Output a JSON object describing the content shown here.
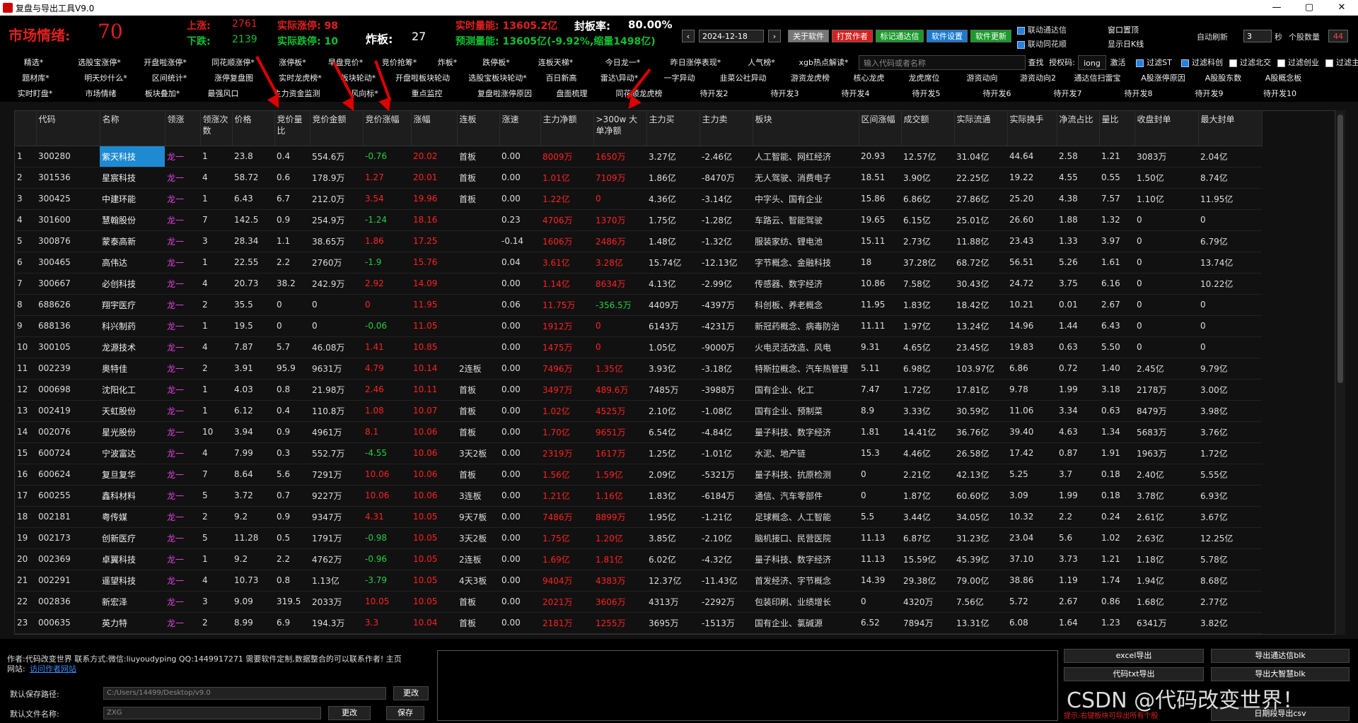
{
  "window": {
    "title": "复盘与导出工具V9.0",
    "minimize": "—",
    "maximize": "▢",
    "close": "✕"
  },
  "stats": {
    "mood_label": "市场情绪:",
    "mood_value": "70",
    "up_label": "上涨:",
    "up_value": "2761",
    "down_label": "下跌:",
    "down_value": "2139",
    "real_limit_up": "实际涨停: 98",
    "real_limit_down": "实际跌停: 10",
    "zhaban_label": "炸板:",
    "zhaban_value": "27",
    "volume_now": "实时量能: 13605.2亿",
    "seal_rate_label": "封板率:",
    "seal_rate_value": "80.00%",
    "volume_pred": "预测量能: 13605亿(-9.92%,缩量1498亿)",
    "date": "2024-12-18",
    "prev": "‹",
    "next": "›",
    "btn_about": "关于软件",
    "btn_reward": "打赏作者",
    "btn_mark": "标记通达信",
    "btn_settings": "软件设置",
    "btn_update": "软件更新",
    "chk_link_tdx": "联动通达信",
    "chk_link_ths": "联动同花顺",
    "win_top": "窗口置顶",
    "show_day_k": "显示日K线",
    "auto_refresh": "自动刷新",
    "refresh_val": "3",
    "refresh_unit": "秒",
    "stock_count_label": "个股数量",
    "stock_count_val": "44"
  },
  "toolbar": {
    "row1": [
      "精选*",
      "选股宝涨停*",
      "开盘啦涨停*",
      "同花顺涨停*",
      "涨停板*",
      "早盘竞价*",
      "竞价抢筹*",
      "炸板*",
      "跌停板*",
      "连板天梯*",
      "今日龙一*",
      "昨日涨停表现*",
      "人气榜*",
      "xgb热点解读*"
    ],
    "search_placeholder": "输入代码或者名称",
    "search_btn": "查找",
    "auth_label": "授权码:",
    "auth_value": "iong",
    "activate": "激活",
    "filters": [
      "过滤ST",
      "过滤科创",
      "过滤北交",
      "过滤创业",
      "过滤主板"
    ],
    "row2": [
      "题材库*",
      "明天炒什么*",
      "区间统计*",
      "涨停复盘图",
      "实时龙虎榜*",
      "板块轮动*",
      "开盘啦板块轮动",
      "选股宝板块轮动*",
      "百日新高",
      "雷达\\异动*",
      "一字异动",
      "韭菜公社异动",
      "游资龙虎榜",
      "核心龙虎",
      "龙虎席位",
      "游资动向",
      "游资动向2",
      "通达信扫雷宝",
      "A股涨停原因",
      "A股股东数",
      "A股概念板"
    ],
    "row3": [
      "实时盯盘*",
      "市场情绪",
      "板块叠加*",
      "最强风口",
      "主力资金监测",
      "风向标*",
      "重点监控",
      "复盘啦涨停原因",
      "盘面梳理",
      "同花顺龙虎榜",
      "待开发2",
      "待开发3",
      "待开发4",
      "待开发5",
      "待开发6",
      "待开发7",
      "待开发8",
      "待开发9",
      "待开发10"
    ]
  },
  "table": {
    "headers": [
      "",
      "代码",
      "名称",
      "领涨",
      "领涨次数",
      "价格",
      "竞价量比",
      "竞价金额",
      "竞价涨幅",
      "涨幅",
      "连板",
      "涨速",
      "主力净额",
      ">300w 大单净额",
      "主力买",
      "主力卖",
      "板块",
      "区间涨幅",
      "成交额",
      "实际流通",
      "实际换手",
      "净流占比",
      "量比",
      "收盘封单",
      "最大封单"
    ],
    "rows": [
      [
        "1",
        "300280",
        "紫天科技",
        "龙一",
        "1",
        "23.8",
        "0.4",
        "554.6万",
        "-0.76",
        "20.02",
        "首板",
        "0.00",
        "8009万",
        "1650万",
        "3.27亿",
        "-2.46亿",
        "人工智能、网红经济",
        "20.93",
        "12.57亿",
        "31.04亿",
        "44.64",
        "2.58",
        "1.21",
        "3083万",
        "2.04亿"
      ],
      [
        "2",
        "301536",
        "星宸科技",
        "龙一",
        "4",
        "58.72",
        "0.6",
        "178.9万",
        "1.27",
        "20.01",
        "首板",
        "0.00",
        "1.01亿",
        "7109万",
        "1.86亿",
        "-8470万",
        "无人驾驶、消费电子",
        "18.51",
        "3.90亿",
        "22.25亿",
        "19.22",
        "4.55",
        "0.55",
        "1.50亿",
        "8.74亿"
      ],
      [
        "3",
        "300425",
        "中建环能",
        "龙一",
        "1",
        "6.43",
        "6.7",
        "212.0万",
        "3.54",
        "19.96",
        "首板",
        "0.00",
        "1.22亿",
        "0",
        "4.36亿",
        "-3.14亿",
        "中字头、国有企业",
        "15.86",
        "6.86亿",
        "27.86亿",
        "25.20",
        "4.38",
        "7.57",
        "1.10亿",
        "11.95亿"
      ],
      [
        "4",
        "301600",
        "慧翰股份",
        "龙一",
        "7",
        "142.5",
        "0.9",
        "254.9万",
        "-1.24",
        "18.16",
        "",
        "0.23",
        "4706万",
        "1370万",
        "1.75亿",
        "-1.28亿",
        "车路云、智能驾驶",
        "19.65",
        "6.15亿",
        "25.01亿",
        "26.60",
        "1.88",
        "1.32",
        "0",
        "0"
      ],
      [
        "5",
        "300876",
        "蒙泰高新",
        "龙一",
        "3",
        "28.34",
        "1.1",
        "38.65万",
        "1.86",
        "17.25",
        "",
        "-0.14",
        "1606万",
        "2486万",
        "1.48亿",
        "-1.32亿",
        "服装家纺、锂电池",
        "15.11",
        "2.73亿",
        "11.88亿",
        "23.43",
        "1.33",
        "3.97",
        "0",
        "6.79亿"
      ],
      [
        "6",
        "300465",
        "高伟达",
        "龙一",
        "1",
        "22.55",
        "2.2",
        "2760万",
        "-1.9",
        "15.76",
        "",
        "0.04",
        "3.61亿",
        "3.28亿",
        "15.74亿",
        "-12.13亿",
        "字节概念、金融科技",
        "18",
        "37.28亿",
        "68.72亿",
        "56.51",
        "5.26",
        "1.61",
        "0",
        "13.74亿"
      ],
      [
        "7",
        "300667",
        "必创科技",
        "龙一",
        "4",
        "20.73",
        "38.2",
        "242.9万",
        "2.92",
        "14.09",
        "",
        "0.00",
        "1.14亿",
        "8634万",
        "4.13亿",
        "-2.99亿",
        "传感器、数字经济",
        "10.86",
        "7.58亿",
        "30.43亿",
        "24.72",
        "3.75",
        "6.16",
        "0",
        "10.22亿"
      ],
      [
        "8",
        "688626",
        "翔宇医疗",
        "龙一",
        "2",
        "35.5",
        "0",
        "0",
        "0",
        "11.95",
        "",
        "0.06",
        "11.75万",
        "-356.5万",
        "4409万",
        "-4397万",
        "科创板、养老概念",
        "11.95",
        "1.83亿",
        "18.42亿",
        "10.21",
        "0.01",
        "2.67",
        "0",
        "0"
      ],
      [
        "9",
        "688136",
        "科兴制药",
        "龙一",
        "1",
        "19.5",
        "0",
        "0",
        "-0.06",
        "11.05",
        "",
        "0.00",
        "1912万",
        "0",
        "6143万",
        "-4231万",
        "新冠药概念、病毒防治",
        "11.11",
        "1.97亿",
        "13.24亿",
        "14.96",
        "1.44",
        "6.43",
        "0",
        "0"
      ],
      [
        "10",
        "300105",
        "龙源技术",
        "龙一",
        "4",
        "7.87",
        "5.7",
        "46.08万",
        "1.41",
        "10.85",
        "",
        "0.00",
        "1475万",
        "0",
        "1.05亿",
        "-9000万",
        "火电灵活改造、风电",
        "9.31",
        "4.65亿",
        "23.45亿",
        "19.83",
        "0.63",
        "5.50",
        "0",
        "0"
      ],
      [
        "11",
        "002239",
        "奥特佳",
        "龙一",
        "2",
        "3.91",
        "95.9",
        "9631万",
        "4.79",
        "10.14",
        "2连板",
        "0.00",
        "7496万",
        "1.35亿",
        "3.93亿",
        "-3.18亿",
        "特斯拉概念、汽车热管理",
        "5.11",
        "6.98亿",
        "103.97亿",
        "6.86",
        "0.72",
        "1.40",
        "2.45亿",
        "9.79亿"
      ],
      [
        "12",
        "000698",
        "沈阳化工",
        "龙一",
        "1",
        "4.03",
        "0.8",
        "21.98万",
        "2.46",
        "10.11",
        "首板",
        "0.00",
        "3497万",
        "489.6万",
        "7485万",
        "-3988万",
        "国有企业、化工",
        "7.47",
        "1.72亿",
        "17.81亿",
        "9.78",
        "1.99",
        "3.18",
        "2178万",
        "3.00亿"
      ],
      [
        "13",
        "002419",
        "天虹股份",
        "龙一",
        "1",
        "6.12",
        "0.4",
        "110.8万",
        "1.08",
        "10.07",
        "首板",
        "0.00",
        "1.02亿",
        "4525万",
        "2.10亿",
        "-1.08亿",
        "国有企业、预制菜",
        "8.9",
        "3.33亿",
        "30.59亿",
        "11.06",
        "3.34",
        "0.63",
        "8479万",
        "3.98亿"
      ],
      [
        "14",
        "002076",
        "星光股份",
        "龙一",
        "10",
        "3.94",
        "0.9",
        "4961万",
        "8.1",
        "10.06",
        "首板",
        "0.00",
        "1.70亿",
        "9651万",
        "6.54亿",
        "-4.84亿",
        "量子科技、数字经济",
        "1.81",
        "14.41亿",
        "36.76亿",
        "39.40",
        "4.63",
        "1.34",
        "5683万",
        "3.76亿"
      ],
      [
        "15",
        "600724",
        "宁波富达",
        "龙一",
        "4",
        "7.99",
        "0.3",
        "552.7万",
        "-4.55",
        "10.06",
        "3天2板",
        "0.00",
        "2319万",
        "1617万",
        "1.25亿",
        "-1.01亿",
        "水泥、地产链",
        "15.3",
        "4.46亿",
        "26.58亿",
        "17.42",
        "0.87",
        "1.91",
        "1963万",
        "1.72亿"
      ],
      [
        "16",
        "600624",
        "复旦复华",
        "龙一",
        "7",
        "8.64",
        "5.6",
        "7291万",
        "10.06",
        "10.06",
        "首板",
        "0.00",
        "1.56亿",
        "1.59亿",
        "2.09亿",
        "-5321万",
        "量子科技、抗原检测",
        "0",
        "2.21亿",
        "42.13亿",
        "5.25",
        "3.7",
        "0.18",
        "2.40亿",
        "5.55亿"
      ],
      [
        "17",
        "600255",
        "鑫科材料",
        "龙一",
        "5",
        "3.72",
        "0.7",
        "9227万",
        "10.06",
        "10.06",
        "3连板",
        "0.00",
        "1.21亿",
        "1.16亿",
        "1.83亿",
        "-6184万",
        "通信、汽车零部件",
        "0",
        "1.87亿",
        "60.60亿",
        "3.09",
        "1.99",
        "0.18",
        "3.78亿",
        "6.93亿"
      ],
      [
        "18",
        "002181",
        "粤传媒",
        "龙一",
        "2",
        "9.2",
        "0.9",
        "9347万",
        "4.31",
        "10.05",
        "9天7板",
        "0.00",
        "7486万",
        "8899万",
        "1.95亿",
        "-1.21亿",
        "足球概念、人工智能",
        "5.5",
        "3.44亿",
        "34.05亿",
        "10.32",
        "2.2",
        "0.24",
        "2.61亿",
        "3.67亿"
      ],
      [
        "19",
        "002173",
        "创新医疗",
        "龙一",
        "5",
        "11.28",
        "0.5",
        "1791万",
        "-0.98",
        "10.05",
        "3天2板",
        "0.00",
        "1.75亿",
        "1.20亿",
        "3.85亿",
        "-2.10亿",
        "脑机接口、民营医院",
        "11.13",
        "6.87亿",
        "31.23亿",
        "23.04",
        "5.6",
        "1.02",
        "2.63亿",
        "12.25亿"
      ],
      [
        "20",
        "002369",
        "卓翼科技",
        "龙一",
        "1",
        "9.2",
        "2.2",
        "4762万",
        "-0.96",
        "10.05",
        "2连板",
        "0.00",
        "1.69亿",
        "1.81亿",
        "6.02亿",
        "-4.32亿",
        "量子科技、数字经济",
        "11.13",
        "15.59亿",
        "45.39亿",
        "37.10",
        "3.73",
        "1.21",
        "1.18亿",
        "5.78亿"
      ],
      [
        "21",
        "002291",
        "遥望科技",
        "龙一",
        "4",
        "10.73",
        "0.8",
        "1.13亿",
        "-3.79",
        "10.05",
        "4天3板",
        "0.00",
        "9404万",
        "4383万",
        "12.37亿",
        "-11.43亿",
        "首发经济、字节概念",
        "14.39",
        "29.38亿",
        "79.00亿",
        "38.86",
        "1.19",
        "1.74",
        "1.94亿",
        "8.68亿"
      ],
      [
        "22",
        "002836",
        "新宏泽",
        "龙一",
        "3",
        "9.09",
        "319.5",
        "2033万",
        "10.05",
        "10.05",
        "首板",
        "0.00",
        "2021万",
        "3606万",
        "4313万",
        "-2292万",
        "包装印刷、业绩增长",
        "0",
        "4320万",
        "7.56亿",
        "5.72",
        "2.67",
        "0.86",
        "1.68亿",
        "2.77亿"
      ],
      [
        "23",
        "000635",
        "英力特",
        "龙一",
        "2",
        "8.99",
        "6.9",
        "194.3万",
        "3.3",
        "10.04",
        "首板",
        "0.00",
        "2181万",
        "1255万",
        "3695万",
        "-1513万",
        "国有企业、氯碱源",
        "6.52",
        "7894万",
        "13.31亿",
        "6.08",
        "1.64",
        "1.23",
        "6341万",
        "3.82亿"
      ]
    ]
  },
  "bottom": {
    "author": "作者:代码改变世界 联系方式:微信:liuyoudyping QQ:1449917271 需要软件定制,数据整合的可以联系作者! 主页",
    "site_label": "网站:",
    "site_link": "访问作者网站",
    "save_path_label": "默认保存路径:",
    "save_path": "C:/Users/14499/Desktop/v9.0",
    "change": "更改",
    "file_name_label": "默认文件名称:",
    "file_name": "ZXG",
    "change2": "更改",
    "save": "保存",
    "excel_export": "excel导出",
    "txt_export": "代码txt导出",
    "export_tdx": "导出通达信blk",
    "export_dzh": "导出大智慧blk",
    "tip": "提示:右键板块可导出所有个股",
    "daily_csv": "日期段导出csv",
    "watermark": "CSDN @代码改变世界！"
  }
}
